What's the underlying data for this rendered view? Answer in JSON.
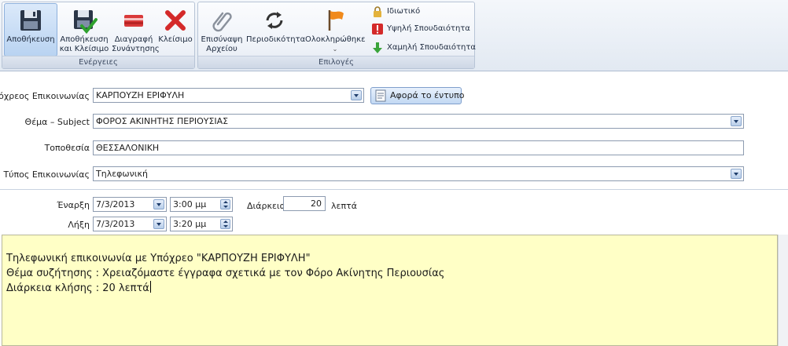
{
  "ribbon": {
    "actions": {
      "group_label": "Ενέργειες",
      "save": "Αποθήκευση",
      "save_close_1": "Αποθήκευση",
      "save_close_2": "και Κλείσιμο",
      "delete_1": "Διαγραφή",
      "delete_2": "Συνάντησης",
      "close": "Κλείσιμο"
    },
    "options": {
      "group_label": "Επιλογές",
      "attach_1": "Επισύναψη",
      "attach_2": "Αρχείου",
      "recurrence": "Περιοδικότητα",
      "completed": "Ολοκληρώθηκε",
      "completed_chevron": "⌄",
      "private": "Ιδιωτικό",
      "high_priority": "Υψηλή Σπουδαιότητα",
      "low_priority": "Χαμηλή Σπουδαιότητα"
    }
  },
  "form": {
    "contact_person_label": "Υπόχρεος Επικοινωνίας",
    "contact_person_value": "ΚΑΡΠΟΥΖΗ ΕΡΙΦΥΛΗ",
    "regards_button": "Αφορά το έντυπο",
    "subject_label": "Θέμα – Subject",
    "subject_value": "ΦΟΡΟΣ ΑΚΙΝΗΤΗΣ ΠΕΡΙΟΥΣΙΑΣ",
    "location_label": "Τοποθεσία",
    "location_value": "ΘΕΣΣΑΛΟΝΙΚΗ",
    "type_label": "Τύπος Επικοινωνίας",
    "type_value": "Τηλεφωνική",
    "start_label": "Έναρξη",
    "start_date": "7/3/2013",
    "start_time": "3:00 μμ",
    "end_label": "Λήξη",
    "end_date": "7/3/2013",
    "end_time": "3:20 μμ",
    "duration_label": "Διάρκεια",
    "duration_value": "20",
    "duration_unit": "λεπτά"
  },
  "notes": {
    "line1": "Τηλεφωνική επικοινωνία με Υπόχρεο \"ΚΑΡΠΟΥΖΗ ΕΡΙΦΥΛΗ\"",
    "line2": "Θέμα συζήτησης :  Χρειαζόμαστε έγγραφα σχετικά με τον Φόρο Ακίνητης Περιουσίας",
    "line3": "Διάρκεια κλήσης : 20 λεπτά"
  },
  "colors": {
    "notes_background": "#ffffc6",
    "ribbon_background": "#e2e9f2",
    "active_button": "#b9d3f1"
  },
  "icons": {
    "save": "floppy-disk-icon",
    "save_close": "floppy-check-icon",
    "delete": "red-card-icon",
    "close": "red-x-icon",
    "attach": "paperclip-icon",
    "recurrence": "circular-arrows-icon",
    "completed": "orange-flag-icon",
    "private": "padlock-icon",
    "high_priority": "exclamation-icon",
    "low_priority": "green-down-arrow-icon",
    "regards": "document-icon"
  }
}
